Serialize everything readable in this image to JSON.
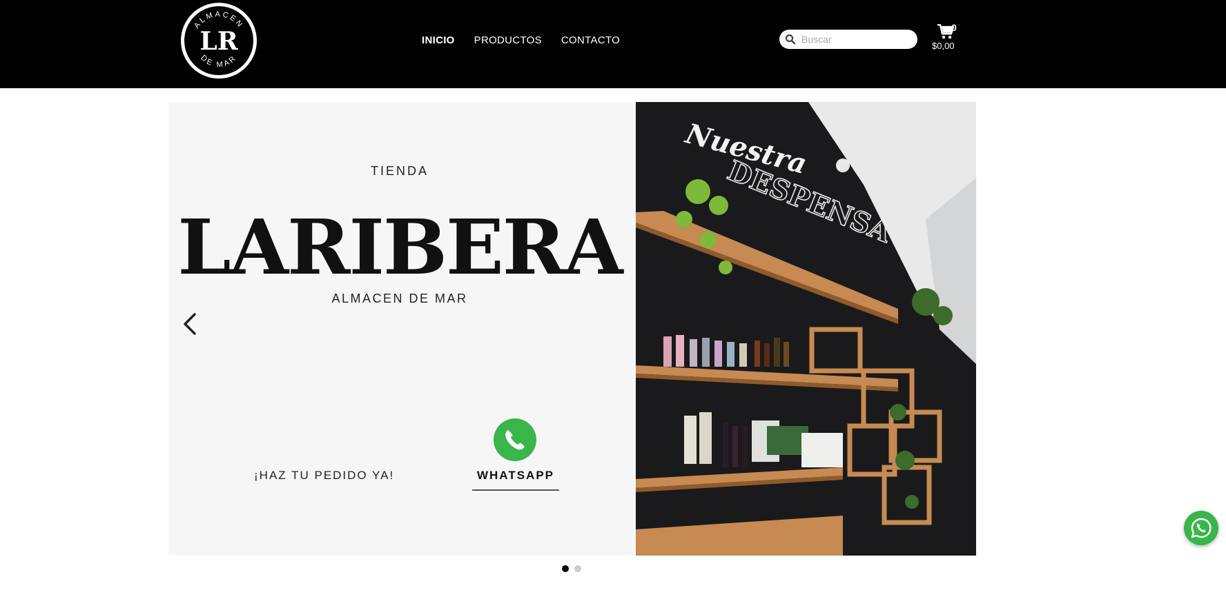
{
  "header": {
    "logo": {
      "top_text": "ALMACEN",
      "monogram": "LR",
      "bottom_text": "DE MAR"
    },
    "nav": [
      {
        "label": "INICIO",
        "active": true
      },
      {
        "label": "PRODUCTOS",
        "active": false
      },
      {
        "label": "CONTACTO",
        "active": false
      }
    ],
    "search": {
      "placeholder": "Buscar",
      "value": "",
      "icon": "search-icon"
    },
    "cart": {
      "count": "0",
      "total": "$0,00",
      "icon": "cart-icon"
    }
  },
  "hero": {
    "kicker": "TIENDA",
    "brand": "LARIBERA",
    "subtitle": "ALMACEN DE MAR",
    "order_text": "¡HAZ TU PEDIDO YA!",
    "whatsapp_label": "WHATSAPP",
    "photo_text_top": "Nuestra",
    "photo_text_main": "DESPENSA"
  },
  "slider": {
    "slides": 2,
    "active": 1
  },
  "colors": {
    "header_bg": "#000000",
    "hero_bg": "#f6f6f6",
    "whatsapp": "#3ab54a"
  }
}
